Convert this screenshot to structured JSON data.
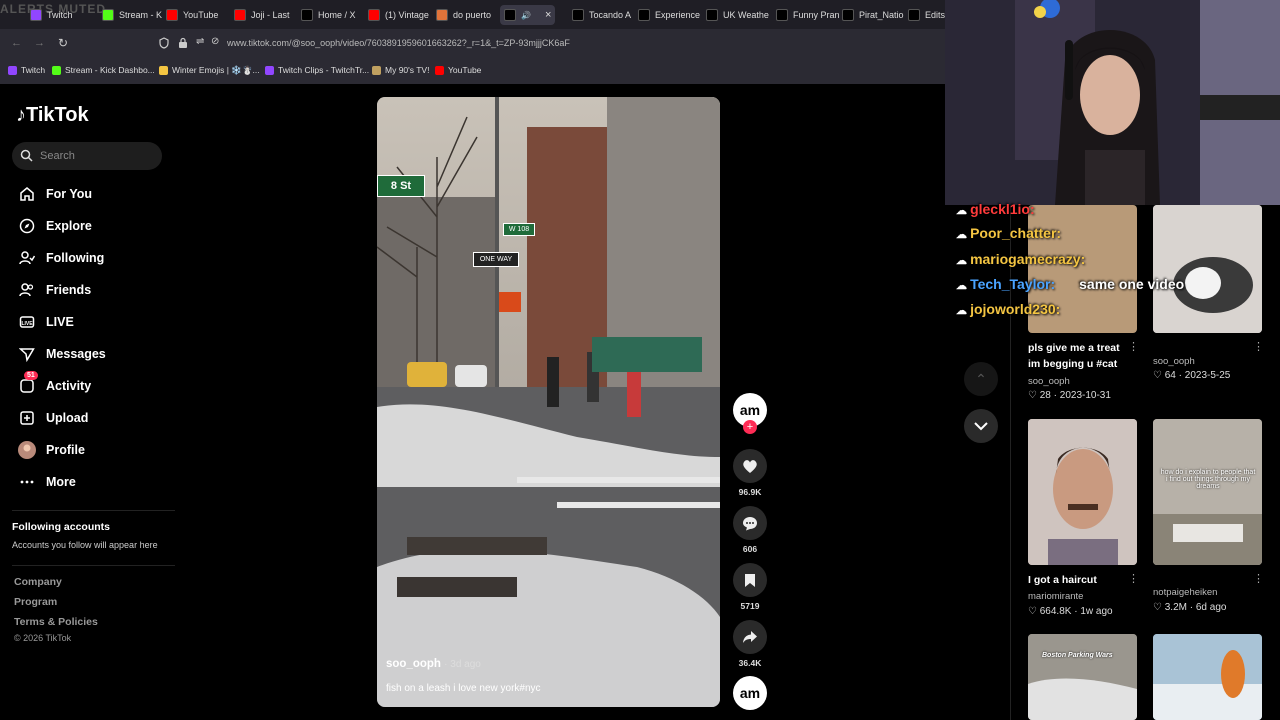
{
  "browser": {
    "overlay_text": "ALERTS MUTED",
    "tabs": [
      {
        "label": "Twitch",
        "color": "#9146ff"
      },
      {
        "label": "Stream - K",
        "color": "#53fc18"
      },
      {
        "label": "YouTube",
        "color": "#ff0000"
      },
      {
        "label": "Joji - Last",
        "color": "#ff0000"
      },
      {
        "label": "Home / X",
        "color": "#000000"
      },
      {
        "label": "(1) Vintage",
        "color": "#ff0000"
      },
      {
        "label": "do puerto",
        "color": "#e0733a"
      },
      {
        "label": "",
        "color": "#000000"
      },
      {
        "label": "Tocando A",
        "color": "#000000"
      },
      {
        "label": "Experience",
        "color": "#000000"
      },
      {
        "label": "UK Weathe",
        "color": "#000000"
      },
      {
        "label": "Funny Pran",
        "color": "#000000"
      },
      {
        "label": "Pirat_Natio",
        "color": "#000000"
      },
      {
        "label": "Edits",
        "color": "#000000"
      }
    ],
    "url": "www.tiktok.com/@soo_ooph/video/7603891959601663262?_r=1&_t=ZP-93mjjjCK6aF",
    "bookmarks": [
      {
        "label": "Twitch",
        "color": "#9146ff"
      },
      {
        "label": "Stream - Kick Dashbo...",
        "color": "#53fc18"
      },
      {
        "label": "Winter Emojis | ❄️☃️...",
        "color": "#f4c542"
      },
      {
        "label": "Twitch Clips - TwitchTr...",
        "color": "#9146ff"
      },
      {
        "label": "My 90's TV!",
        "color": "#c0a060"
      },
      {
        "label": "YouTube",
        "color": "#ff0000"
      }
    ]
  },
  "sidebar": {
    "logo": "TikTok",
    "search_placeholder": "Search",
    "nav": [
      {
        "label": "For You",
        "icon": "home-icon"
      },
      {
        "label": "Explore",
        "icon": "compass-icon"
      },
      {
        "label": "Following",
        "icon": "following-icon"
      },
      {
        "label": "Friends",
        "icon": "friends-icon"
      },
      {
        "label": "LIVE",
        "icon": "live-icon"
      },
      {
        "label": "Messages",
        "icon": "paper-plane-icon"
      },
      {
        "label": "Activity",
        "icon": "activity-icon",
        "badge": "51"
      },
      {
        "label": "Upload",
        "icon": "plus-square-icon"
      },
      {
        "label": "Profile",
        "icon": "avatar-icon"
      },
      {
        "label": "More",
        "icon": "ellipsis-icon"
      }
    ],
    "following_title": "Following accounts",
    "following_sub": "Accounts you follow will appear here",
    "footer": [
      "Company",
      "Program",
      "Terms & Policies"
    ],
    "copyright": "© 2026 TikTok"
  },
  "video": {
    "author": "soo_ooph",
    "time": "· 3d ago",
    "caption": "fish on a leash i love new york#nyc",
    "street_sign": "8 St",
    "street_sign2": "W 108",
    "one_way": "ONE WAY"
  },
  "actions": {
    "avatar_text": "am",
    "likes": "96.9K",
    "comments": "606",
    "saves": "5719",
    "shares": "36.4K"
  },
  "grid": [
    {
      "title": "pls give me a treat im begging u #cat",
      "author": "soo_ooph",
      "stats": "28 · 2023-10-31"
    },
    {
      "title": "",
      "author": "soo_ooph",
      "stats": "64 · 2023-5-25"
    },
    {
      "title": "I got a haircut",
      "author": "mariomirante",
      "stats": "664.8K · 1w ago"
    },
    {
      "title": "",
      "author": "notpaigeheiken",
      "stats": "3.2M · 6d ago"
    }
  ],
  "grid_overlay_text": "how do i explain to people that i find out things through my dreams",
  "grid_overlay_text2": "Boston Parking Wars",
  "chat": [
    {
      "name": "gleckl1io:",
      "color": "#ff3b3b"
    },
    {
      "name": "Poor_chatter:",
      "color": "#f4c542"
    },
    {
      "name": "mariogamecrazy:",
      "color": "#f4c542"
    },
    {
      "name": "Tech_Taylor:",
      "color": "#4aa3ff",
      "msg": "same one video"
    },
    {
      "name": "jojoworld230:",
      "color": "#f4c542"
    }
  ]
}
